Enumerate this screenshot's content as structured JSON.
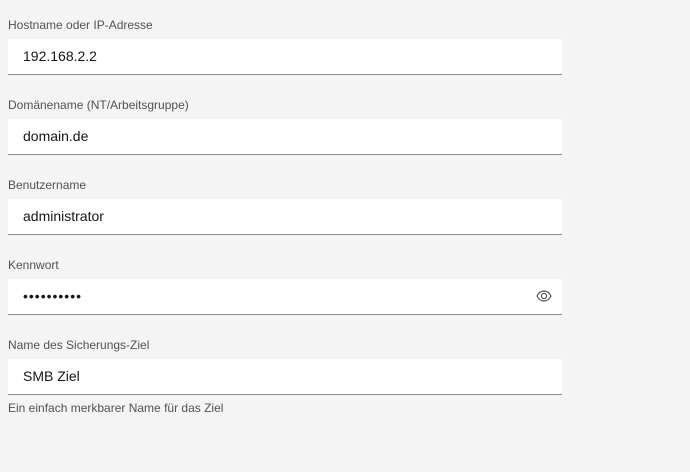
{
  "form": {
    "hostname": {
      "label": "Hostname oder IP-Adresse",
      "value": "192.168.2.2"
    },
    "domain": {
      "label": "Domänename (NT/Arbeitsgruppe)",
      "value": "domain.de"
    },
    "username": {
      "label": "Benutzername",
      "value": "administrator"
    },
    "password": {
      "label": "Kennwort",
      "value": "••••••••••",
      "toggle_icon": "eye-icon"
    },
    "target_name": {
      "label": "Name des Sicherungs-Ziel",
      "value": "SMB Ziel",
      "helper": "Ein einfach merkbarer Name für das Ziel"
    }
  }
}
